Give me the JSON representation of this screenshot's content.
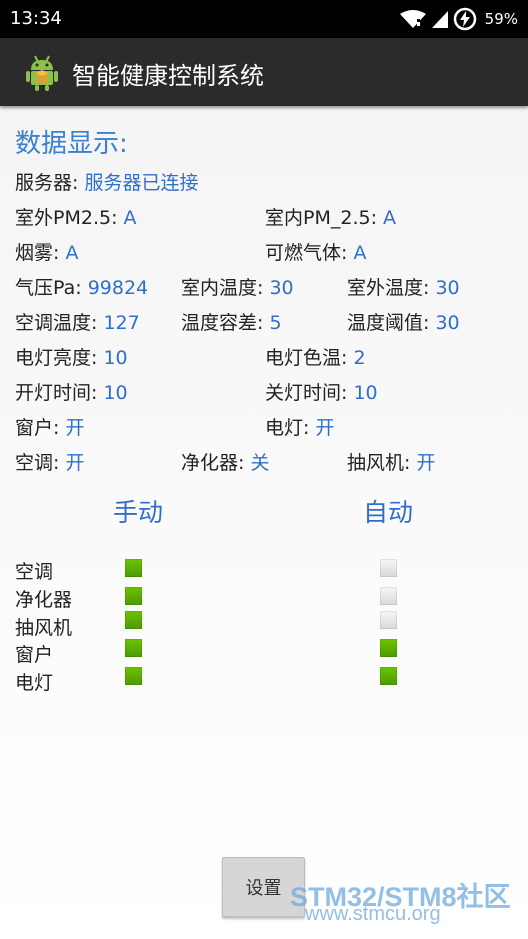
{
  "status_bar": {
    "time": "13:34",
    "battery": "59%"
  },
  "app": {
    "title": "智能健康控制系统"
  },
  "section_title": "数据显示:",
  "rows": {
    "server": {
      "label": "服务器: ",
      "value": "服务器已连接"
    },
    "outdoor_pm": {
      "label": "室外PM2.5: ",
      "value": "A"
    },
    "indoor_pm": {
      "label": "室内PM_2.5: ",
      "value": "A"
    },
    "smoke": {
      "label": "烟雾: ",
      "value": "A"
    },
    "gas": {
      "label": "可燃气体: ",
      "value": "A"
    },
    "pressure": {
      "label": "气压Pa: ",
      "value": "99824"
    },
    "indoor_temp": {
      "label": "室内温度: ",
      "value": "30"
    },
    "outdoor_temp": {
      "label": "室外温度: ",
      "value": "30"
    },
    "ac_temp": {
      "label": "空调温度: ",
      "value": "127"
    },
    "temp_tolerance": {
      "label": "温度容差: ",
      "value": "5"
    },
    "temp_threshold": {
      "label": "温度阈值: ",
      "value": "30"
    },
    "light_brightness": {
      "label": "电灯亮度: ",
      "value": "10"
    },
    "light_color_temp": {
      "label": "电灯色温: ",
      "value": "2"
    },
    "light_on_time": {
      "label": "开灯时间: ",
      "value": "10"
    },
    "light_off_time": {
      "label": "关灯时间: ",
      "value": "10"
    },
    "window": {
      "label": "窗户: ",
      "value": "开"
    },
    "light": {
      "label": "电灯: ",
      "value": "开"
    },
    "ac": {
      "label": "空调: ",
      "value": "开"
    },
    "purifier": {
      "label": "净化器: ",
      "value": "关"
    },
    "exhaust_fan": {
      "label": "抽风机: ",
      "value": "开"
    }
  },
  "modes": {
    "manual": "手动",
    "auto": "自动"
  },
  "devices": [
    {
      "label": "空调",
      "manual_on": true,
      "auto_on": false
    },
    {
      "label": "净化器",
      "manual_on": true,
      "auto_on": false
    },
    {
      "label": "抽风机",
      "manual_on": true,
      "auto_on": false
    },
    {
      "label": "窗户",
      "manual_on": true,
      "auto_on": true
    },
    {
      "label": "电灯",
      "manual_on": true,
      "auto_on": true
    }
  ],
  "colors": {
    "on": "#5cb000",
    "off": "#e0e0e0",
    "accent": "#2f6fc9",
    "action_bar": "#2b2b2b"
  },
  "settings_button": "设置",
  "watermark": {
    "brand": "STM32/STM8社区",
    "url": "www.stmcu.org"
  }
}
